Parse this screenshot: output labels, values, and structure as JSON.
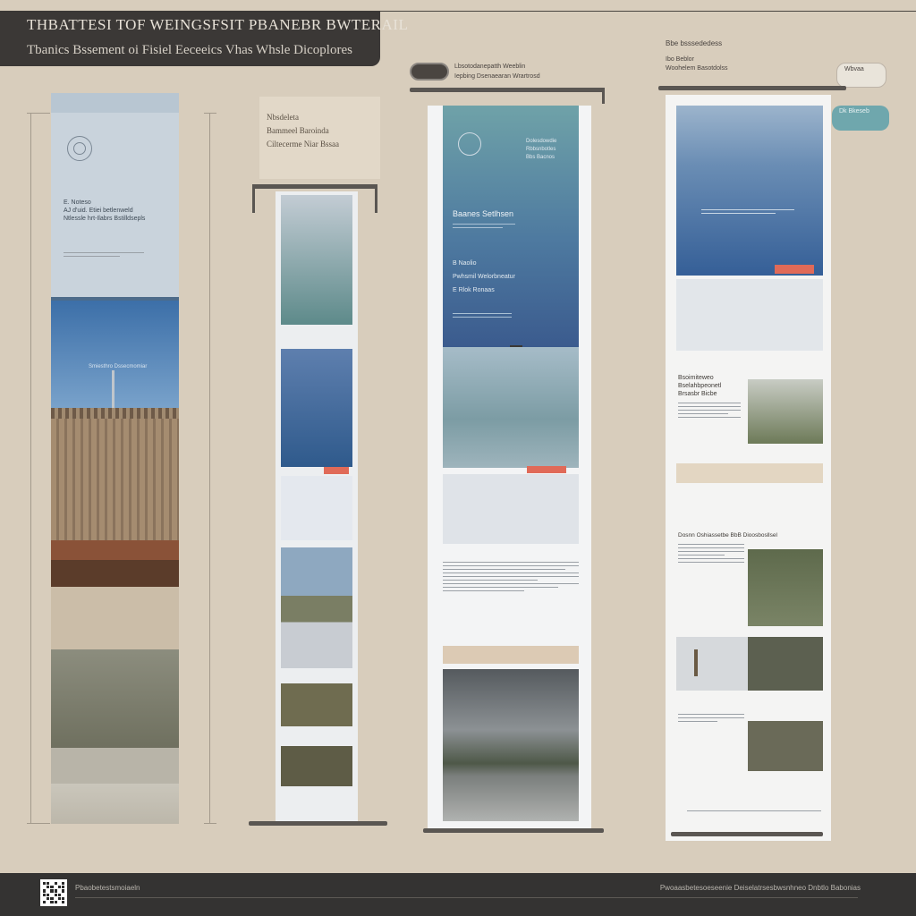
{
  "header": {
    "title": "THBATTESI TOF WEINGSFSIT PBANEBR BWTERAIL",
    "subtitle": "Tbanics Bssement oi Fisiel Eeceeics Vhas Whsle Dicoplores"
  },
  "panel1": {
    "lines": [
      "E. Noteso",
      "AJ d'uid. Etiei betlenweld",
      "Ntlessle hrt-Ilabrs Bstilldsepls"
    ],
    "caption": "Smiesthro  Dssecmomiar"
  },
  "panel2": {
    "label_lines": [
      "Nbsdeleta",
      "Bammeel  Baroinda",
      "Ciltecerme Niar  Bssaa"
    ]
  },
  "panel3": {
    "tag_title": "Lbsotodanepatth Weeblin",
    "tag_subtitle": "Iepbing  Dsenaearan Wrartrosd",
    "side_lines": [
      "Dolesdowdie",
      "Rbbsnbotles",
      "Bbs  Bacnos"
    ],
    "heading": "Baanes  Setlhsen",
    "items": [
      "B  Naolio",
      "Pwhsmil  Welorbneatur",
      "E  Rlok  Ronaas"
    ]
  },
  "panel4": {
    "top_label": "Bbe  bsssededess",
    "top_label2": "Ibo  Beblor",
    "top_label3": "Woohelem Basotdolss",
    "pill1": "Wbvaa",
    "pill2": "Dk  Bkeseb",
    "section1": [
      "Bsoimiteweo",
      "Bselahbpeonetl",
      "Brsasbr  Bicbe"
    ],
    "section2_title": "Dosnn  Oshiassetbe  BbB  Dioosbosllsel"
  },
  "footer": {
    "left": "Pbaobetestsmoiaeln",
    "right": "Pwoaasbetesoeseenie  Deiselatrsesbwsnhneo  Dnbtlo  Babonias"
  }
}
